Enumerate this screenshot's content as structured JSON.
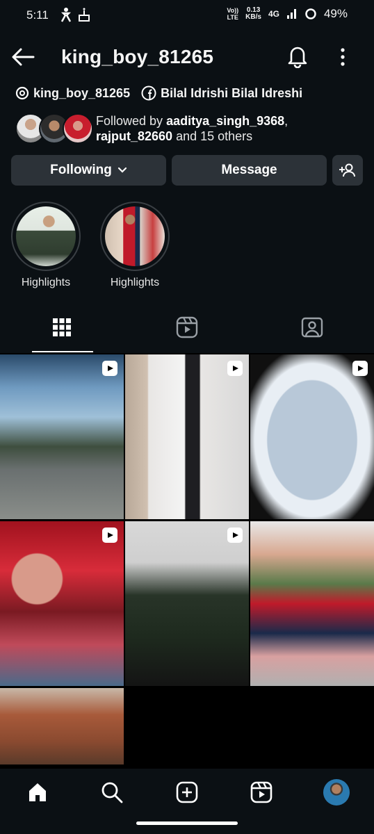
{
  "status_bar": {
    "time": "5:11",
    "volte_line1": "Vo))",
    "volte_line2": "LTE",
    "speed_value": "0.13",
    "speed_unit": "KB/s",
    "network": "4G",
    "battery_percent": "49%"
  },
  "header": {
    "username": "king_boy_81265"
  },
  "profile": {
    "threads_handle": "king_boy_81265",
    "facebook_name": "Bilal Idrishi Bilal Idreshi",
    "followed_by_prefix": "Followed by ",
    "followed_by_user1": "aaditya_singh_9368",
    "followed_by_comma": ",",
    "followed_by_user2": "rajput_82660",
    "followed_by_suffix": " and 15 others"
  },
  "buttons": {
    "following_label": "Following",
    "message_label": "Message"
  },
  "highlights": [
    {
      "label": "Highlights"
    },
    {
      "label": "Highlights"
    }
  ],
  "tabs": [
    "grid-icon",
    "reels-icon",
    "tagged-icon"
  ],
  "bottom_nav": [
    "home-icon",
    "search-icon",
    "create-icon",
    "reels-icon",
    "profile-avatar"
  ],
  "colors": {
    "background": "#0b1014",
    "button": "#2c3238",
    "text": "#f5f5f5"
  }
}
